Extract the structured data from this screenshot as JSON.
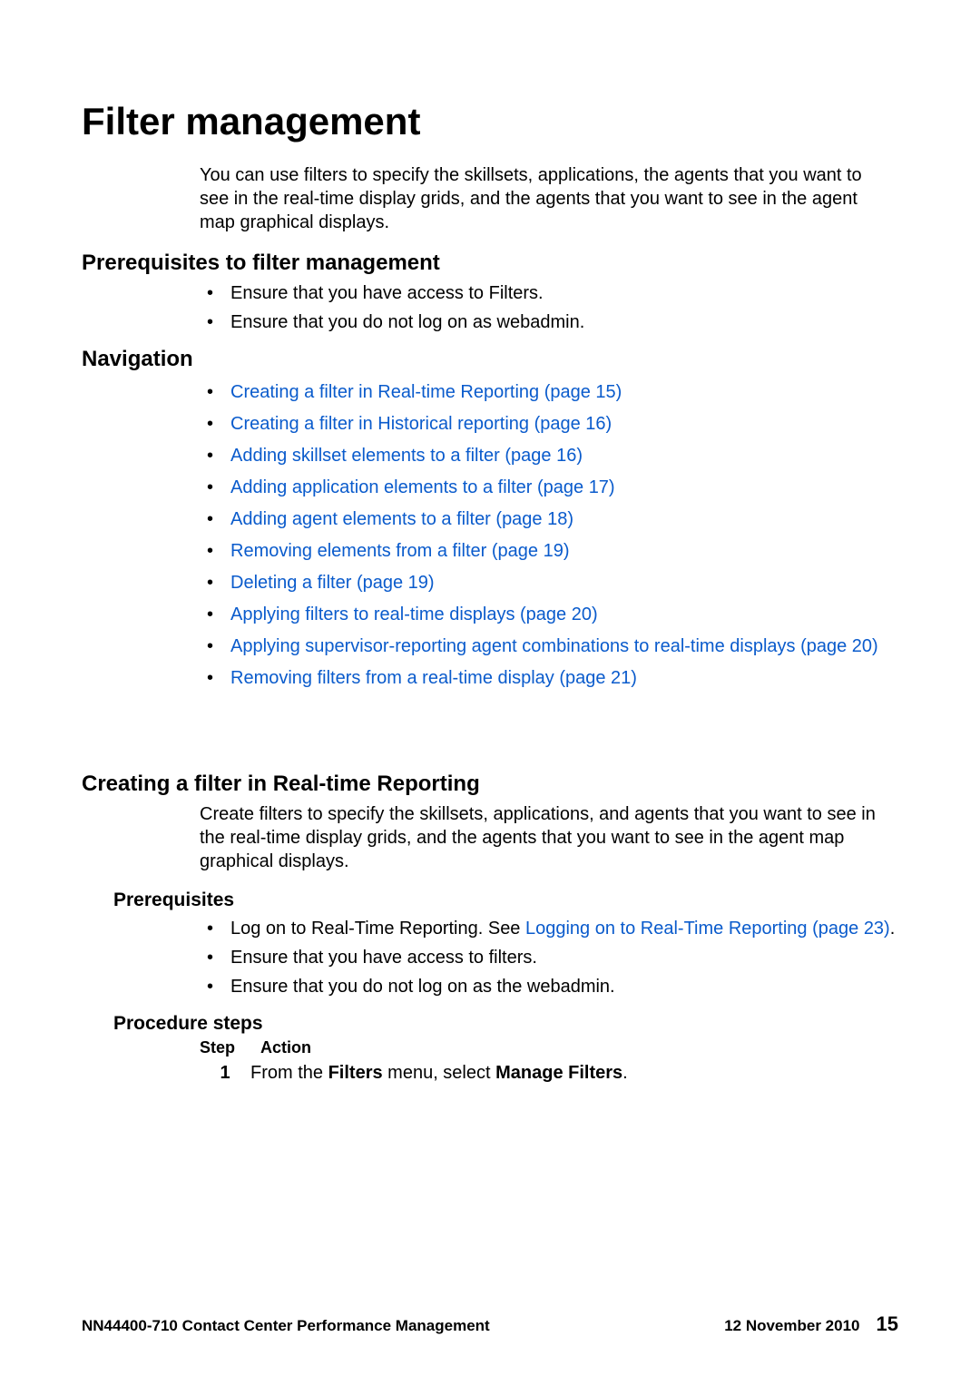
{
  "title": "Filter management",
  "intro": "You can use filters to specify the skillsets, applications, the agents that you want to see in the real-time display grids, and the agents that you want to see in the agent map graphical displays.",
  "prereq_heading": "Prerequisites to filter management",
  "prereq_items": [
    "Ensure that you have access to Filters.",
    "Ensure that you do not log on as webadmin."
  ],
  "nav_heading": "Navigation",
  "nav_items": [
    "Creating a filter in Real-time Reporting (page 15)",
    "Creating a filter in Historical reporting (page 16)",
    "Adding skillset elements to a filter (page 16)",
    "Adding application elements to a filter (page 17)",
    "Adding agent elements to a filter (page 18)",
    "Removing elements from a filter (page 19)",
    "Deleting a filter (page 19)",
    "Applying filters to real-time displays (page 20)",
    "Applying supervisor-reporting agent combinations to real-time displays (page 20)",
    "Removing filters from a real-time display (page 21)"
  ],
  "section_heading": "Creating a filter in Real-time Reporting",
  "section_intro": "Create filters to specify the skillsets, applications, and agents that you want to see in the real-time display grids, and the agents that you want to see in the agent map graphical displays.",
  "sub_prereq_heading": "Prerequisites",
  "sub_prereq": {
    "item0_pre": "Log on to Real-Time Reporting. See ",
    "item0_link": "Logging on to Real-Time Reporting (page 23)",
    "item0_post": ".",
    "item1": "Ensure that you have access to filters.",
    "item2": "Ensure that you do not log on as the webadmin."
  },
  "proc_heading": "Procedure steps",
  "proc_col_step": "Step",
  "proc_col_action": "Action",
  "step1_num": "1",
  "step1_pre": "From the ",
  "step1_b1": "Filters",
  "step1_mid": " menu, select ",
  "step1_b2": "Manage Filters",
  "step1_post": ".",
  "footer_doc": "NN44400-710 Contact Center Performance Management",
  "footer_date": "12 November 2010",
  "footer_page": "15"
}
